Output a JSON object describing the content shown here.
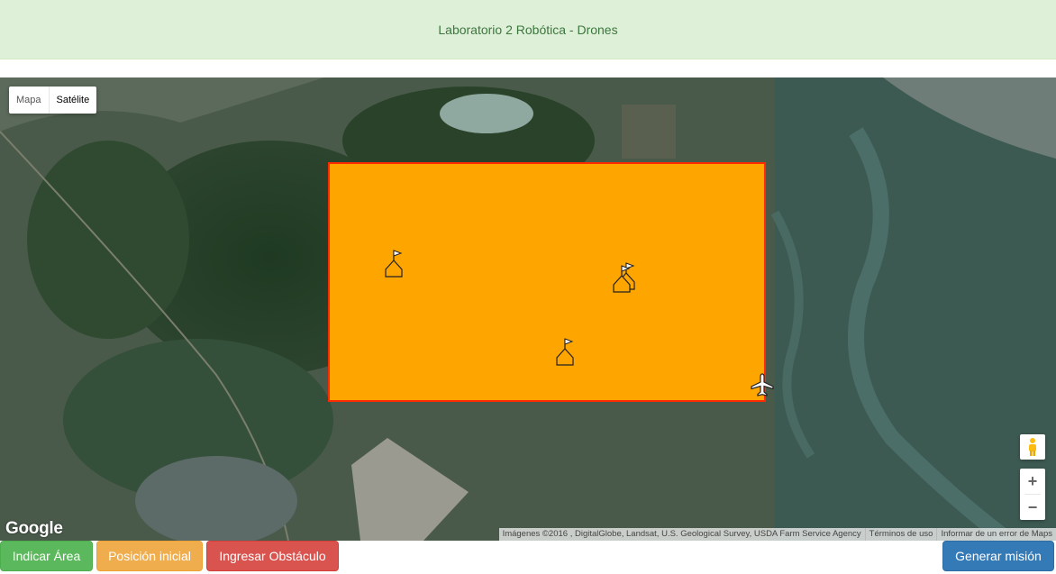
{
  "header": {
    "title": "Laboratorio 2 Robótica - Drones"
  },
  "map": {
    "type_control": {
      "map_label": "Mapa",
      "satellite_label": "Satélite",
      "selected": "Satélite"
    },
    "area_colors": {
      "fill": "#ffa500",
      "border": "#ff2a00"
    },
    "markers": [
      {
        "kind": "flag-marker-icon"
      },
      {
        "kind": "flag-marker-icon"
      },
      {
        "kind": "flag-marker-icon"
      },
      {
        "kind": "flag-marker-icon"
      }
    ],
    "drone": {
      "icon": "airplane-icon"
    },
    "zoom": {
      "in_label": "+",
      "out_label": "−"
    },
    "logo": "Google",
    "attribution": {
      "imagery": "Imágenes ©2016 , DigitalGlobe, Landsat, U.S. Geological Survey, USDA Farm Service Agency",
      "terms": "Términos de uso",
      "report": "Informar de un error de Maps"
    }
  },
  "toolbar": {
    "area_label": "Indicar Área",
    "position_label": "Posición inicial",
    "obstacle_label": "Ingresar Obstáculo",
    "generate_label": "Generar misión"
  },
  "colors": {
    "success": "#5cb85c",
    "warning": "#f0ad4e",
    "danger": "#d9534f",
    "primary": "#337ab7"
  }
}
